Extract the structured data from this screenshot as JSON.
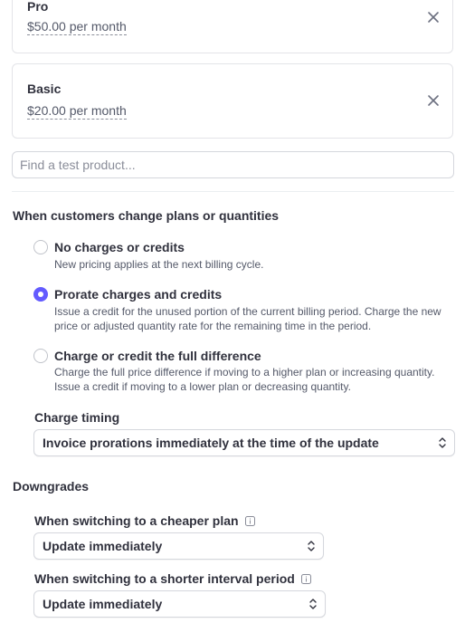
{
  "products": [
    {
      "name": "Pro",
      "price": "$50.00 per month",
      "remove_icon": "close-icon"
    },
    {
      "name": "Basic",
      "price": "$20.00 per month",
      "remove_icon": "close-icon"
    }
  ],
  "search": {
    "placeholder": "Find a test product..."
  },
  "proration": {
    "title": "When customers change plans or quantities",
    "options": [
      {
        "label": "No charges or credits",
        "description": "New pricing applies at the next billing cycle.",
        "selected": false
      },
      {
        "label": "Prorate charges and credits",
        "description": "Issue a credit for the unused portion of the current billing period. Charge the new price or adjusted quantity rate for the remaining time in the period.",
        "selected": true
      },
      {
        "label": "Charge or credit the full difference",
        "description": "Charge the full price difference if moving to a higher plan or increasing quantity. Issue a credit if moving to a lower plan or decreasing quantity.",
        "selected": false
      }
    ],
    "charge_timing": {
      "label": "Charge timing",
      "value": "Invoice prorations immediately at the time of the update"
    }
  },
  "downgrades": {
    "title": "Downgrades",
    "cheaper_plan": {
      "label": "When switching to a cheaper plan",
      "value": "Update immediately",
      "info_icon": "info-icon"
    },
    "shorter_interval": {
      "label": "When switching to a shorter interval period",
      "value": "Update immediately",
      "info_icon": "info-icon"
    }
  },
  "colors": {
    "accent": "#635bff",
    "text": "#30313d",
    "muted": "#545969",
    "border": "#d5d7dd"
  }
}
